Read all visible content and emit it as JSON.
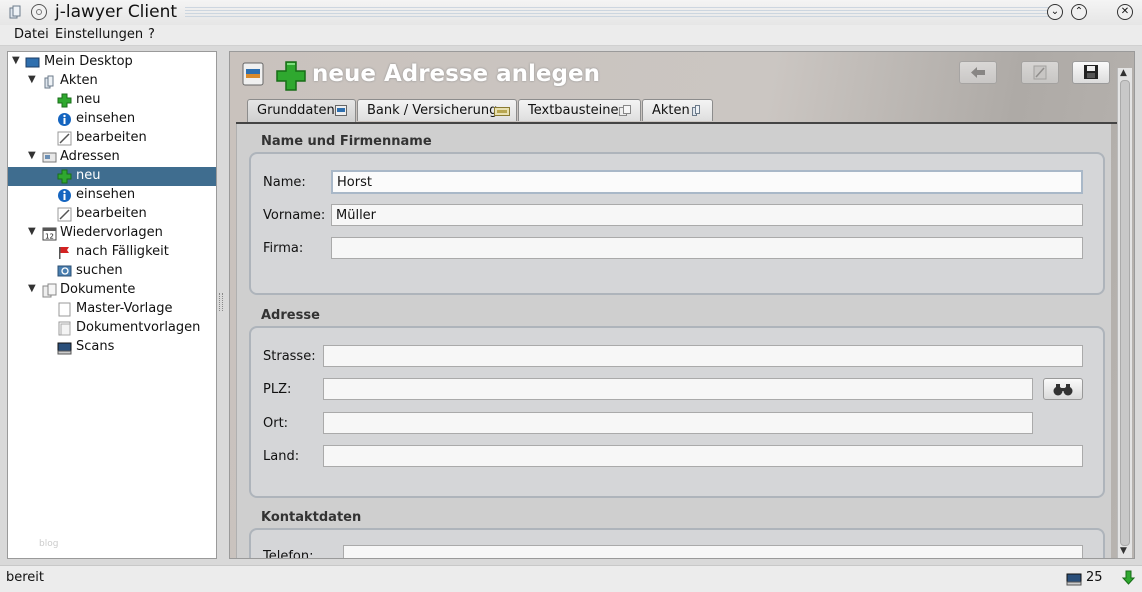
{
  "window": {
    "title": "j-lawyer Client"
  },
  "menu": [
    "Datei",
    "Einstellungen",
    "?"
  ],
  "tree": [
    {
      "label": "Mein Desktop",
      "icon": "desktop-icon",
      "level": 0,
      "expanded": true
    },
    {
      "label": "Akten",
      "icon": "folder-icon",
      "level": 1,
      "expanded": true
    },
    {
      "label": "neu",
      "icon": "plus-icon",
      "level": 2
    },
    {
      "label": "einsehen",
      "icon": "info-icon",
      "level": 2
    },
    {
      "label": "bearbeiten",
      "icon": "edit-icon",
      "level": 2
    },
    {
      "label": "Adressen",
      "icon": "address-book-icon",
      "level": 1,
      "expanded": true
    },
    {
      "label": "neu",
      "icon": "plus-icon",
      "level": 2,
      "selected": true
    },
    {
      "label": "einsehen",
      "icon": "info-icon",
      "level": 2
    },
    {
      "label": "bearbeiten",
      "icon": "edit-icon",
      "level": 2
    },
    {
      "label": "Wiedervorlagen",
      "icon": "calendar-icon",
      "level": 1,
      "expanded": true
    },
    {
      "label": "nach Fälligkeit",
      "icon": "flag-icon",
      "level": 2
    },
    {
      "label": "suchen",
      "icon": "search-icon",
      "level": 2
    },
    {
      "label": "Dokumente",
      "icon": "documents-icon",
      "level": 1,
      "expanded": true
    },
    {
      "label": "Master-Vorlage",
      "icon": "document-icon",
      "level": 2
    },
    {
      "label": "Dokumentvorlagen",
      "icon": "document-icon",
      "level": 2
    },
    {
      "label": "Scans",
      "icon": "scanner-icon",
      "level": 2
    }
  ],
  "sidebar_watermark": "blog",
  "page": {
    "title": "neue Adresse anlegen"
  },
  "tabs": [
    {
      "label": "Grunddaten",
      "active": true
    },
    {
      "label": "Bank / Versicherung"
    },
    {
      "label": "Textbausteine"
    },
    {
      "label": "Akten"
    }
  ],
  "sections": {
    "name": {
      "title": "Name und Firmenname",
      "fields": {
        "name": {
          "label": "Name:",
          "value": "Horst"
        },
        "vorname": {
          "label": "Vorname:",
          "value": "Müller"
        },
        "firma": {
          "label": "Firma:",
          "value": ""
        }
      }
    },
    "adresse": {
      "title": "Adresse",
      "fields": {
        "strasse": {
          "label": "Strasse:",
          "value": ""
        },
        "plz": {
          "label": "PLZ:",
          "value": ""
        },
        "ort": {
          "label": "Ort:",
          "value": ""
        },
        "land": {
          "label": "Land:",
          "value": ""
        }
      }
    },
    "kontakt": {
      "title": "Kontaktdaten",
      "fields": {
        "telefon": {
          "label": "Telefon:",
          "value": ""
        }
      }
    }
  },
  "status": {
    "text": "bereit",
    "count": "25"
  },
  "colors": {
    "selection": "#3f6d8f",
    "plus_green": "#2fa82f",
    "info_blue": "#1565c0"
  }
}
